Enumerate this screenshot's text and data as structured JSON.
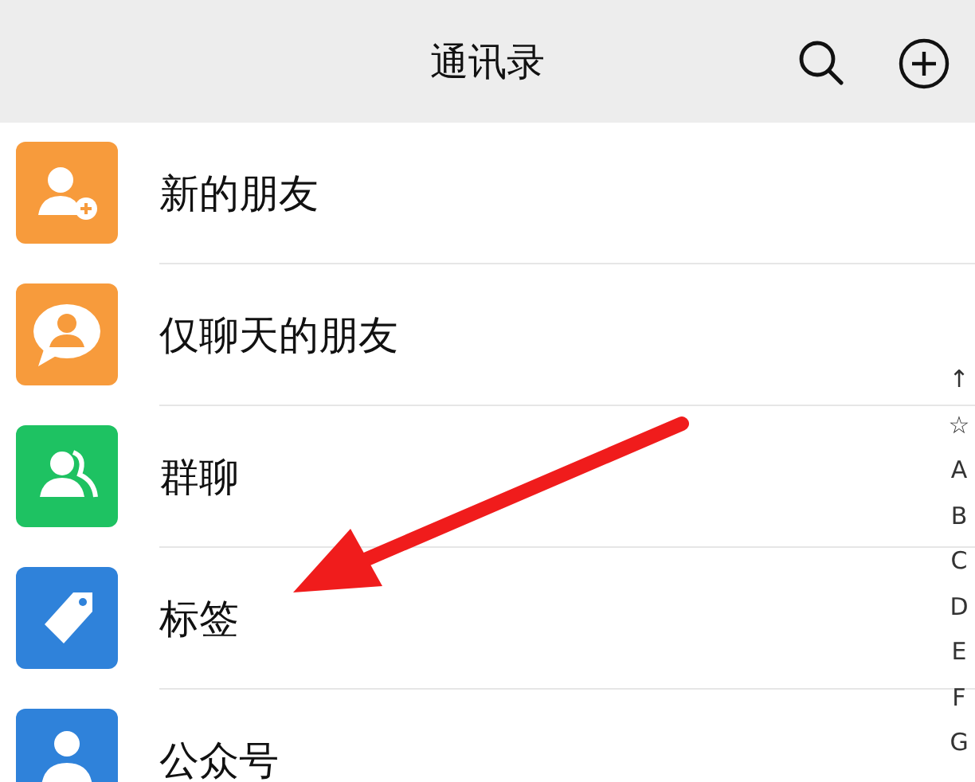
{
  "header": {
    "title": "通讯录"
  },
  "items": [
    {
      "label": "新的朋友",
      "kind": "addperson",
      "color": "#f79b3c"
    },
    {
      "label": "仅聊天的朋友",
      "kind": "chat",
      "color": "#f79b3c"
    },
    {
      "label": "群聊",
      "kind": "group",
      "color": "#1ec262"
    },
    {
      "label": "标签",
      "kind": "tag",
      "color": "#2f82da"
    },
    {
      "label": "公众号",
      "kind": "account",
      "color": "#2f82da"
    }
  ],
  "index_bar": [
    "↑",
    "☆",
    "A",
    "B",
    "C",
    "D",
    "E",
    "F",
    "G"
  ]
}
